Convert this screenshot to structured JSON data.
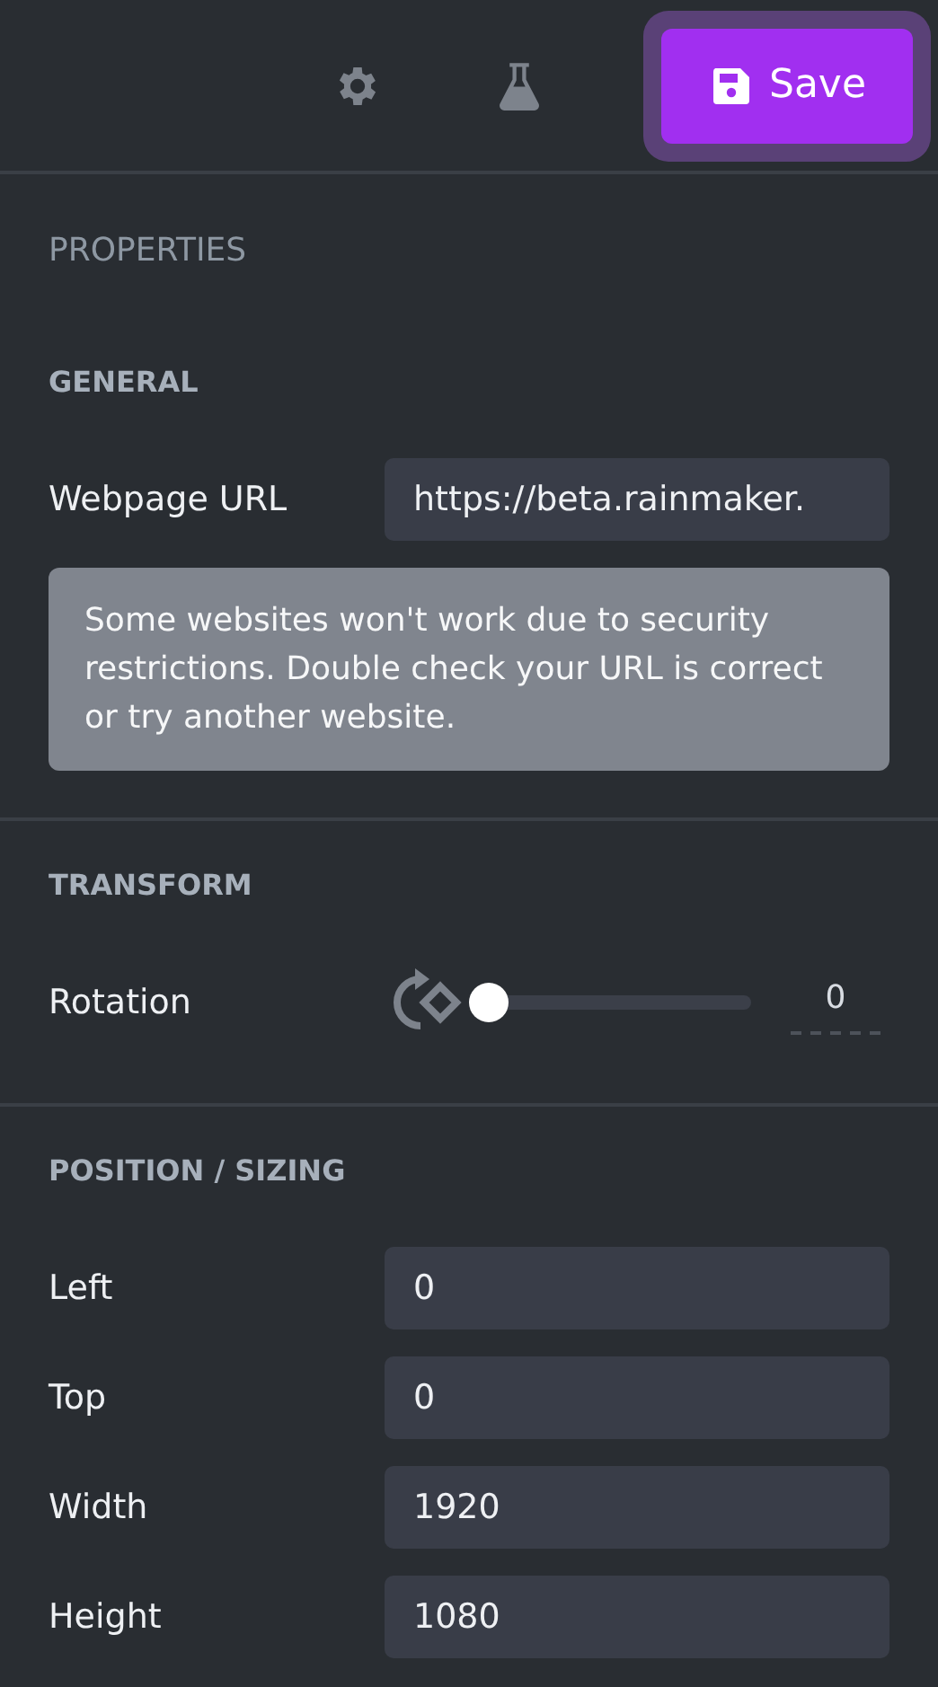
{
  "toolbar": {
    "save_button": {
      "label": "Save"
    }
  },
  "panel": {
    "title": "PROPERTIES"
  },
  "sections": [
    {
      "heading": "GENERAL",
      "rows": [
        {
          "kind": "text",
          "label": "Webpage URL",
          "value": "https://beta.rainmaker."
        }
      ],
      "notice": "Some websites won't work due to security restrictions. Double check your URL is correct or try another website."
    },
    {
      "heading": "TRANSFORM",
      "rows": [
        {
          "kind": "slider",
          "label": "Rotation",
          "level": 0,
          "reading": "0"
        }
      ]
    },
    {
      "heading": "POSITION / SIZING",
      "rows": [
        {
          "kind": "text",
          "label": "Left",
          "value": "0"
        },
        {
          "kind": "text",
          "label": "Top",
          "value": "0"
        },
        {
          "kind": "text",
          "label": "Width",
          "value": "1920"
        },
        {
          "kind": "text",
          "label": "Height",
          "value": "1080"
        }
      ]
    }
  ]
}
